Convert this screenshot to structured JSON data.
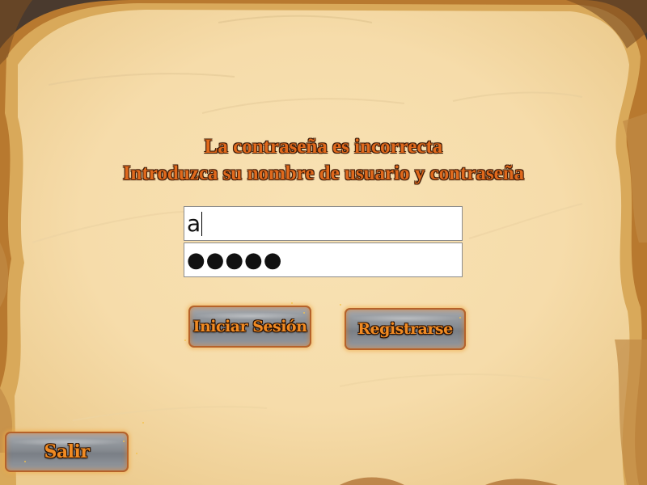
{
  "message": {
    "line1": "La contraseña es incorrecta",
    "line2": "Introduzca su nombre de usuario y contraseña"
  },
  "login_form": {
    "username_value": "a",
    "password_masked": "●●●●●"
  },
  "buttons": {
    "login_label": "Iniciar Sesión",
    "register_label": "Registrarse",
    "exit_label": "Salir"
  },
  "colors": {
    "parchment": "#f6deae",
    "message_text": "#e0691c",
    "button_border": "#b5622a"
  }
}
